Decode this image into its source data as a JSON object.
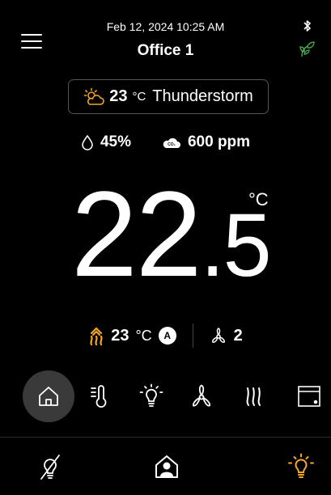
{
  "header": {
    "datetime": "Feb 12, 2024  10:25 AM",
    "room": "Office 1",
    "menu_icon": "hamburger-menu-icon",
    "bluetooth_icon": "bluetooth-icon",
    "eco_icon": "leaf-icon"
  },
  "weather": {
    "icon": "partly-sunny-icon",
    "temp": "23",
    "unit": "°C",
    "condition": "Thunderstorm"
  },
  "environment": {
    "humidity": "45%",
    "co2": "600 ppm",
    "humidity_icon": "droplet-icon",
    "co2_icon": "co2-cloud-icon"
  },
  "current_temp": {
    "integer": "22",
    "decimal": "5",
    "unit": "°C"
  },
  "setpoint": {
    "heat_icon": "heating-icon",
    "value": "23",
    "unit": "°C",
    "mode": "A",
    "fan_icon": "fan-icon",
    "fan_speed": "2"
  },
  "tabs": [
    {
      "icon": "home-icon",
      "active": true
    },
    {
      "icon": "thermometer-icon",
      "active": false
    },
    {
      "icon": "lightbulb-icon",
      "active": false
    },
    {
      "icon": "fan-icon",
      "active": false
    },
    {
      "icon": "heating-icon",
      "active": false
    },
    {
      "icon": "blind-icon",
      "active": false
    }
  ],
  "bottom_bar": [
    {
      "icon": "light-off-icon"
    },
    {
      "icon": "home-presence-icon"
    },
    {
      "icon": "light-on-icon"
    }
  ],
  "colors": {
    "accent_orange": "#f5a623",
    "eco_green": "#4caf50",
    "background": "#000000"
  }
}
